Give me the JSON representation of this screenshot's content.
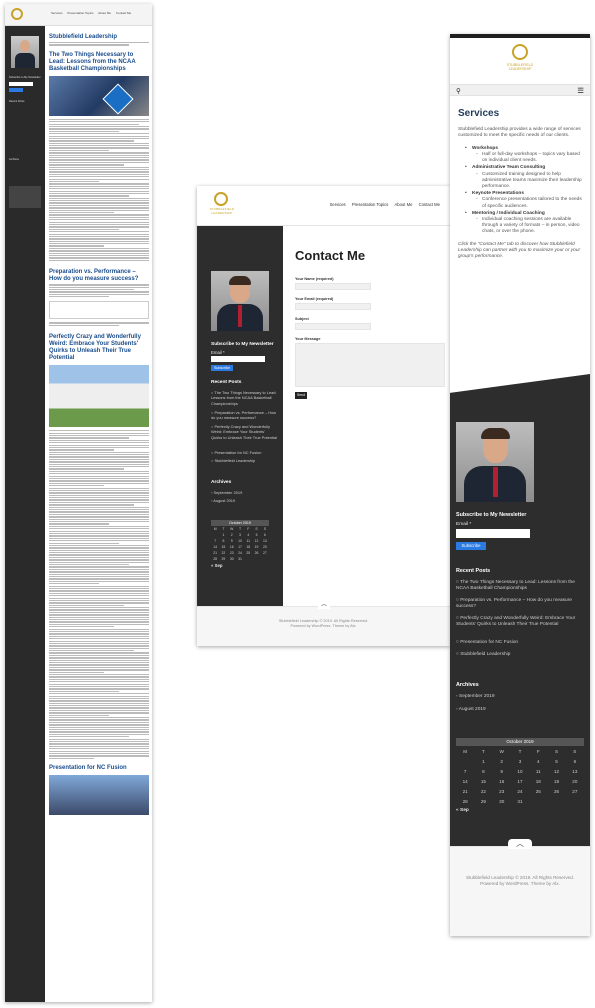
{
  "site": {
    "name": "Stubblefield Leadership",
    "logo_line1": "STUBBLEFIELD",
    "logo_line2": "LEADERSHIP"
  },
  "nav": [
    "Services",
    "Presentation Topics",
    "About Me",
    "Contact Me"
  ],
  "blog": {
    "page_title": "Stubblefield Leadership",
    "posts": [
      {
        "title": "The Two Things Necessary to Lead: Lessons from the NCAA Basketball Championships"
      },
      {
        "title": "Preparation vs. Performance – How do you measure success?"
      },
      {
        "title": "Perfectly Crazy and Wonderfully Weird: Embrace Your Students' Quirks to Unleash Their True Potential"
      },
      {
        "title": "Presentation for NC Fusion"
      }
    ]
  },
  "contact": {
    "title": "Contact Me",
    "fields": {
      "name": "Your Name (required)",
      "email": "Your Email (required)",
      "subject": "Subject",
      "message": "Your Message"
    },
    "send_label": "Send"
  },
  "sidebar": {
    "newsletter_heading": "Subscribe to My Newsletter",
    "email_label": "Email *",
    "subscribe_label": "Subscribe",
    "recent_posts_heading": "Recent Posts",
    "recent_posts": [
      "The Two Things Necessary to Lead: Lessons from the NCAA Basketball Championships",
      "Preparation vs. Performance – How do you measure success?",
      "Perfectly Crazy and Wonderfully Weird: Embrace Your Students' Quirks to Unleash Their True Potential",
      "Presentation for NC Fusion",
      "Stubblefield Leadership"
    ],
    "archives_heading": "Archives",
    "archives": [
      "September 2019",
      "August 2019"
    ],
    "calendar": {
      "month": "October 2019",
      "days": [
        "M",
        "T",
        "W",
        "T",
        "F",
        "S",
        "S"
      ],
      "weeks": [
        [
          "",
          "1",
          "2",
          "3",
          "4",
          "5",
          "6"
        ],
        [
          "7",
          "8",
          "9",
          "10",
          "11",
          "12",
          "13"
        ],
        [
          "14",
          "15",
          "16",
          "17",
          "18",
          "19",
          "20"
        ],
        [
          "21",
          "22",
          "23",
          "24",
          "25",
          "26",
          "27"
        ],
        [
          "28",
          "29",
          "30",
          "31",
          "",
          "",
          ""
        ]
      ],
      "prev": "« Sep"
    }
  },
  "services": {
    "title": "Services",
    "intro": "Stubblefield Leadership provides a wide range of services customized to meet the specific needs of our clients.",
    "items": [
      {
        "name": "Workshops",
        "detail": "Half or full-day workshops – topics vary based on individual client needs."
      },
      {
        "name": "Administrative Team Consulting",
        "detail": "Customized training designed to help administrative teams maximize their leadership performance."
      },
      {
        "name": "Keynote Presentations",
        "detail": "Conference presentations tailored to the needs of specific audiences."
      },
      {
        "name": "Mentoring / Individual Coaching",
        "detail": "Individual coaching sessions are available through a variety of formats – in person, video chats, or over the phone."
      }
    ],
    "outro": "Click the \"Contact Me\" tab to discover how Stubblefield Leadership can partner with you to maximize your or your group's performance."
  },
  "footer": {
    "copyright": "Stubblefield Leadership © 2019. All Rights Reserved.",
    "powered": "Powered by WordPress. Theme by Alx."
  },
  "colors": {
    "sidebar_dark": "#2d2d2d",
    "accent_blue": "#2a7ae2",
    "gold": "#c9a227",
    "title_blue": "#1f3b59"
  },
  "icons": [
    "search-icon",
    "menu-icon",
    "chevron-up-icon"
  ]
}
